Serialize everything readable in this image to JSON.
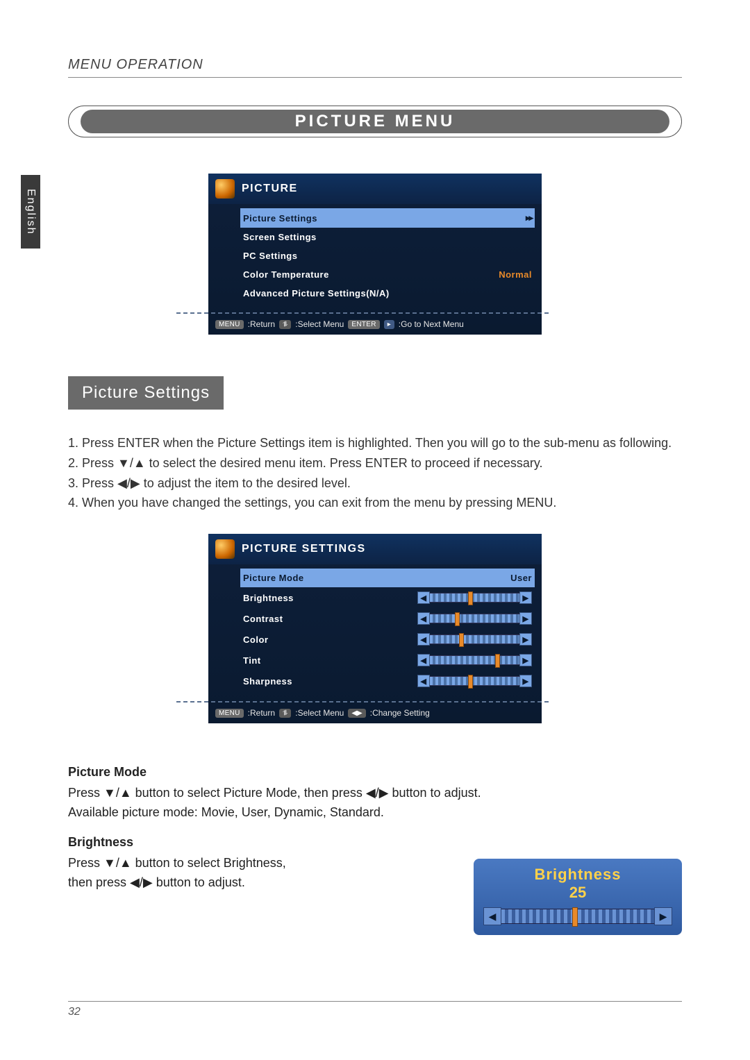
{
  "lang_tab": "English",
  "header_label": "MENU OPERATION",
  "title_pill": "PICTURE MENU",
  "osd1": {
    "title": "PICTURE",
    "rows": [
      {
        "label": "Picture Settings",
        "value": "▸▸",
        "selected": true
      },
      {
        "label": "Screen Settings",
        "value": ""
      },
      {
        "label": "PC Settings",
        "value": ""
      },
      {
        "label": "Color Temperature",
        "value": "Normal"
      },
      {
        "label": "Advanced Picture Settings(N/A)",
        "value": ""
      }
    ],
    "foot": {
      "menu_chip": "MENU",
      "return": ":Return",
      "sel_icon": "⥮",
      "select": ":Select Menu",
      "enter_chip": "ENTER",
      "play_icon": "▸",
      "goto": ":Go to Next Menu"
    }
  },
  "section_heading": "Picture Settings",
  "steps": [
    "Press ENTER when the Picture Settings item is highlighted. Then you will go to the sub-menu as following.",
    "Press ▼/▲ to select the desired menu item. Press ENTER to proceed if necessary.",
    "Press ◀/▶ to adjust the item to the desired level.",
    "When you have changed the settings, you can exit from the menu by pressing MENU."
  ],
  "osd2": {
    "title": "PICTURE SETTINGS",
    "mode_row": {
      "label": "Picture Mode",
      "value": "User"
    },
    "sliders": [
      {
        "label": "Brightness",
        "pos": 45
      },
      {
        "label": "Contrast",
        "pos": 30
      },
      {
        "label": "Color",
        "pos": 35
      },
      {
        "label": "Tint",
        "pos": 75
      },
      {
        "label": "Sharpness",
        "pos": 45
      }
    ],
    "foot": {
      "menu_chip": "MENU",
      "return": ":Return",
      "sel_icon": "⥮",
      "select": ":Select Menu",
      "lr_icon": "◀▶",
      "change": ":Change Setting"
    }
  },
  "pm": {
    "title": "Picture Mode",
    "line1": "Press ▼/▲ button to select Picture Mode, then press ◀/▶ button to adjust.",
    "line2": "Available picture mode: Movie, User, Dynamic, Standard."
  },
  "br": {
    "title": "Brightness",
    "line1": "Press ▼/▲ button to select Brightness,",
    "line2": "then press ◀/▶ button to adjust."
  },
  "bright_popup": {
    "title": "Brightness",
    "value": "25",
    "pos": 48
  },
  "page_number": "32"
}
